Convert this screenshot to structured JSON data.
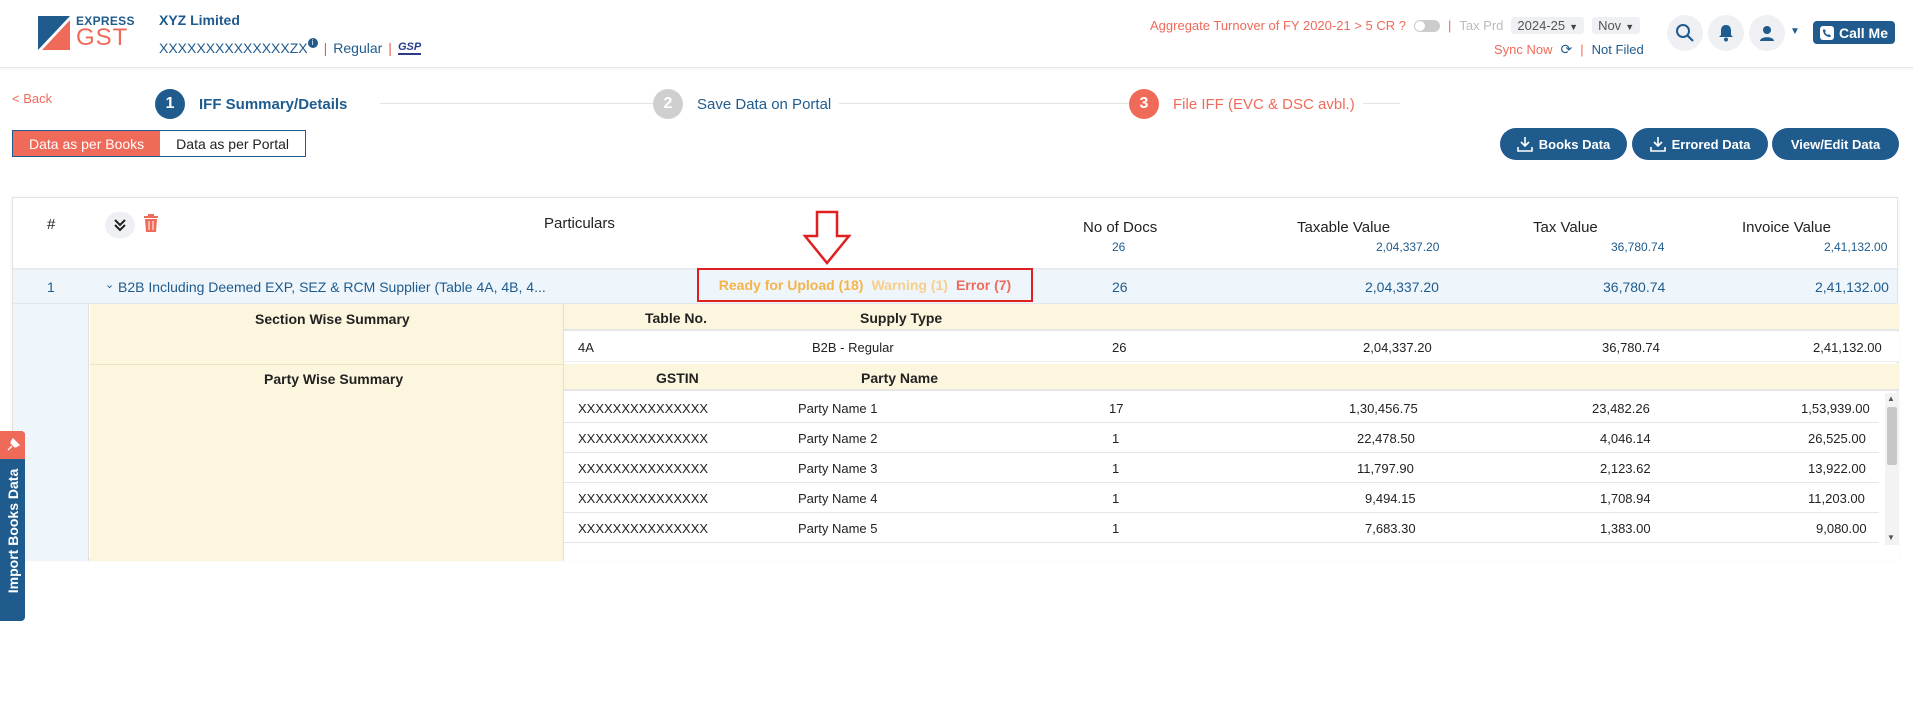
{
  "brand": {
    "top": "EXPRESS",
    "main": "GST"
  },
  "header": {
    "company": "XYZ Limited",
    "gstin": "XXXXXXXXXXXXXXZX",
    "reg_type": "Regular",
    "gsp_mark": "GSP",
    "turnover_text": "Aggregate Turnover of FY 2020-21 > 5 CR ?",
    "tax_prd_label": "Tax Prd",
    "year": "2024-25",
    "month": "Nov",
    "sync_now": "Sync Now",
    "status": "Not Filed",
    "call_me": "Call Me"
  },
  "nav": {
    "back": "< Back"
  },
  "steps": [
    {
      "num": "1",
      "label": "IFF Summary/Details",
      "color": "#1f5b8d"
    },
    {
      "num": "2",
      "label": "Save Data on Portal",
      "color": "#cfcfcf"
    },
    {
      "num": "3",
      "label": "File IFF (EVC & DSC avbl.)",
      "color": "#f06a5a"
    }
  ],
  "view_tabs": {
    "books": "Data as per Books",
    "portal": "Data as per Portal"
  },
  "actions": {
    "books_data": "Books Data",
    "errored_data": "Errored Data",
    "view_edit": "View/Edit Data"
  },
  "table": {
    "headers": {
      "index": "#",
      "particulars": "Particulars",
      "no_docs": "No of Docs",
      "taxable": "Taxable Value",
      "tax": "Tax Value",
      "invoice": "Invoice Value"
    },
    "totals": {
      "no_docs": "26",
      "taxable": "2,04,337.20",
      "tax": "36,780.74",
      "invoice": "2,41,132.00"
    },
    "b2b": {
      "index": "1",
      "label": "B2B Including Deemed EXP, SEZ & RCM Supplier (Table 4A, 4B, 4...",
      "ready": "Ready for Upload (18)",
      "warning": "Warning (1)",
      "error": "Error (7)",
      "no_docs": "26",
      "taxable": "2,04,337.20",
      "tax": "36,780.74",
      "invoice": "2,41,132.00"
    },
    "section_summary": {
      "title": "Section Wise Summary",
      "col_table": "Table No.",
      "col_supply": "Supply Type",
      "row": {
        "table_no": "4A",
        "supply_type": "B2B - Regular",
        "no_docs": "26",
        "taxable": "2,04,337.20",
        "tax": "36,780.74",
        "invoice": "2,41,132.00"
      }
    },
    "party_summary": {
      "title": "Party Wise Summary",
      "col_gstin": "GSTIN",
      "col_name": "Party Name",
      "rows": [
        {
          "gstin": "XXXXXXXXXXXXXXX",
          "name": "Party Name 1",
          "docs": "17",
          "taxable": "1,30,456.75",
          "tax": "23,482.26",
          "invoice": "1,53,939.00"
        },
        {
          "gstin": "XXXXXXXXXXXXXXX",
          "name": "Party Name 2",
          "docs": "1",
          "taxable": "22,478.50",
          "tax": "4,046.14",
          "invoice": "26,525.00"
        },
        {
          "gstin": "XXXXXXXXXXXXXXX",
          "name": "Party Name 3",
          "docs": "1",
          "taxable": "11,797.90",
          "tax": "2,123.62",
          "invoice": "13,922.00"
        },
        {
          "gstin": "XXXXXXXXXXXXXXX",
          "name": "Party Name 4",
          "docs": "1",
          "taxable": "9,494.15",
          "tax": "1,708.94",
          "invoice": "11,203.00"
        },
        {
          "gstin": "XXXXXXXXXXXXXXX",
          "name": "Party Name 5",
          "docs": "1",
          "taxable": "7,683.30",
          "tax": "1,383.00",
          "invoice": "9,080.00"
        }
      ]
    }
  },
  "side_tab": {
    "label": "Import Books Data"
  }
}
